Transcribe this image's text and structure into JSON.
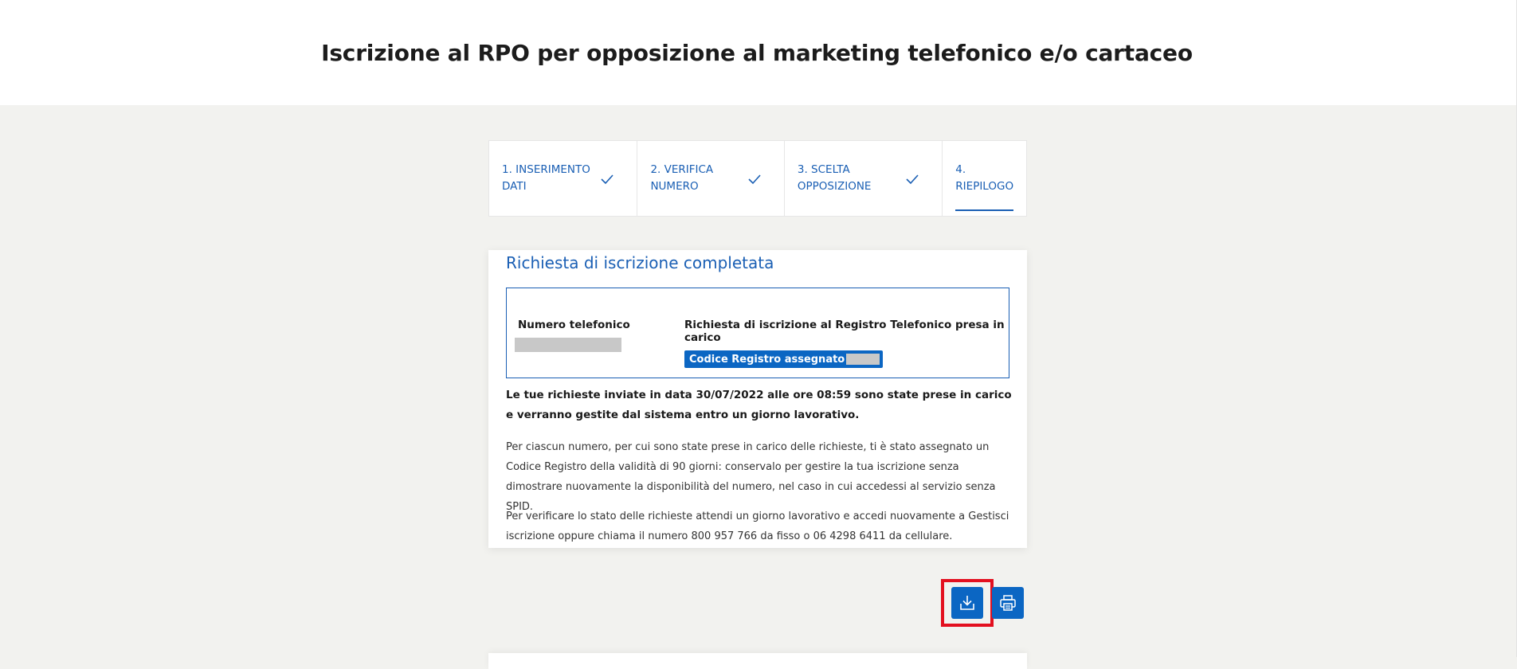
{
  "header": {
    "title": "Iscrizione al RPO per opposizione al marketing telefonico e/o cartaceo"
  },
  "steps": [
    {
      "line1": "1. INSERIMENTO",
      "line2": "DATI",
      "done": true
    },
    {
      "line1": "2. VERIFICA",
      "line2": "NUMERO",
      "done": true
    },
    {
      "line1": "3. SCELTA",
      "line2": "OPPOSIZIONE",
      "done": true
    },
    {
      "line1": "4.",
      "line2": "RIEPILOGO",
      "done": false
    }
  ],
  "card": {
    "title": "Richiesta di iscrizione completata",
    "phone_label": "Numero telefonico",
    "request_label": "Richiesta di iscrizione al Registro Telefonico presa in carico",
    "code_label": "Codice Registro assegnato",
    "summary": "Le tue richieste inviate in data 30/07/2022 alle ore 08:59 sono state prese in carico e verranno gestite dal sistema entro un giorno lavorativo.",
    "para1": "Per ciascun numero, per cui sono state prese in carico delle richieste, ti è stato assegnato un Codice Registro della validità di 90 giorni: conservalo per gestire la tua iscrizione senza dimostrare nuovamente la disponibilità del numero, nel caso in cui accedessi al servizio senza SPID.",
    "para2": "Per verificare lo stato delle richieste attendi un giorno lavorativo e accedi nuovamente a Gestisci iscrizione oppure chiama il numero 800 957 766 da fisso o 06 4298 6411 da cellulare."
  },
  "actions": {
    "download_icon": "download-icon",
    "print_icon": "print-icon"
  },
  "colors": {
    "accent": "#1a5fb4",
    "button": "#0b66c3",
    "highlight": "#e3101f",
    "background": "#f2f2ef"
  }
}
